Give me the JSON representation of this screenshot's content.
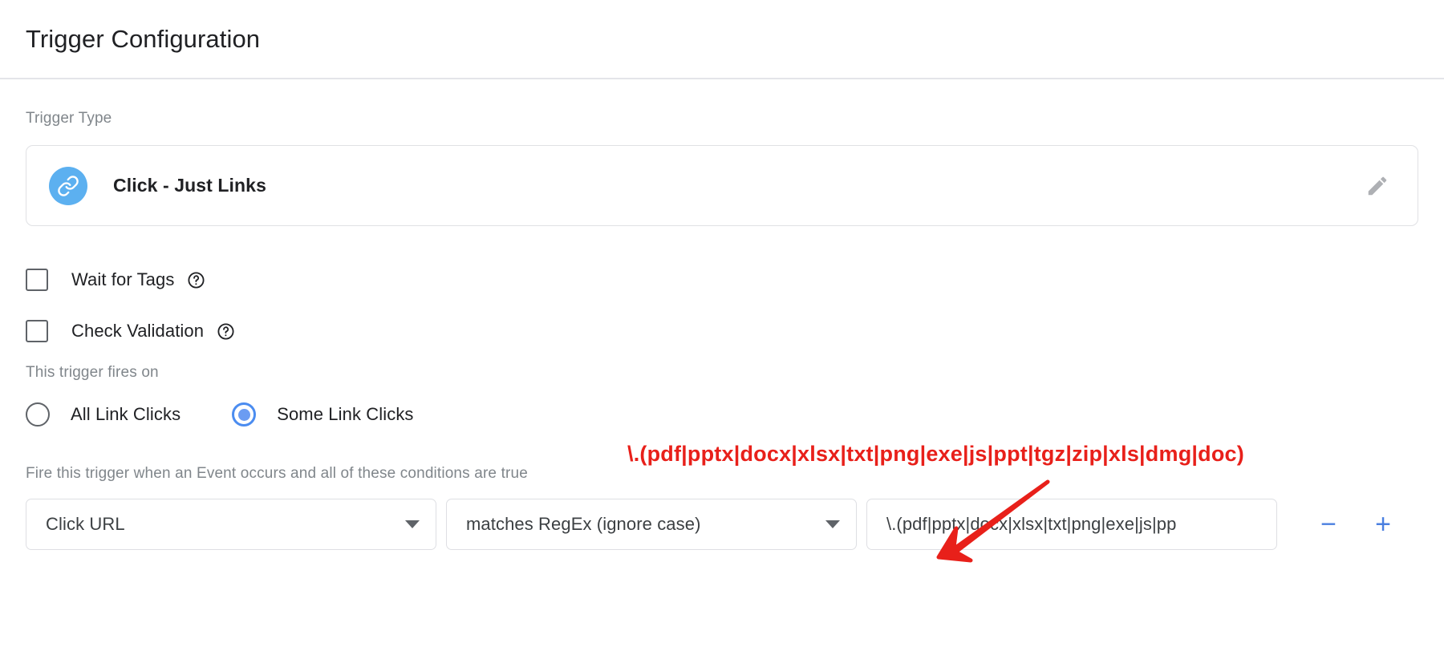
{
  "header": {
    "title": "Trigger Configuration"
  },
  "trigger_type": {
    "label": "Trigger Type",
    "name": "Click - Just Links",
    "icon": "link-icon",
    "icon_color": "#5cb0f0",
    "edit_icon": "pencil-icon"
  },
  "options": {
    "checkboxes": [
      {
        "label": "Wait for Tags",
        "checked": false,
        "help_icon": "help-circle-icon"
      },
      {
        "label": "Check Validation",
        "checked": false,
        "help_icon": "help-circle-icon"
      }
    ]
  },
  "fires_on": {
    "label": "This trigger fires on",
    "selected": "Some Link Clicks",
    "accent_color": "#4b8cf0",
    "radios": [
      {
        "label": "All Link Clicks",
        "selected": false
      },
      {
        "label": "Some Link Clicks",
        "selected": true
      }
    ]
  },
  "conditions": {
    "hint": "Fire this trigger when an Event occurs and all of these conditions are true",
    "row": {
      "variable": "Click URL",
      "operator": "matches RegEx (ignore case)",
      "value": "\\.(pdf|pptx|docx|xlsx|txt|png|exe|js|pp",
      "value_placeholder": "Enter value",
      "remove_label": "−",
      "add_label": "+",
      "button_color": "#4a7fe0"
    }
  },
  "annotation": {
    "regex_text": "\\.(pdf|pptx|docx|xlsx|txt|png|exe|js|ppt|tgz|zip|xls|dmg|doc)",
    "color": "#e8201a",
    "arrow": "arrow-down-left-icon"
  }
}
